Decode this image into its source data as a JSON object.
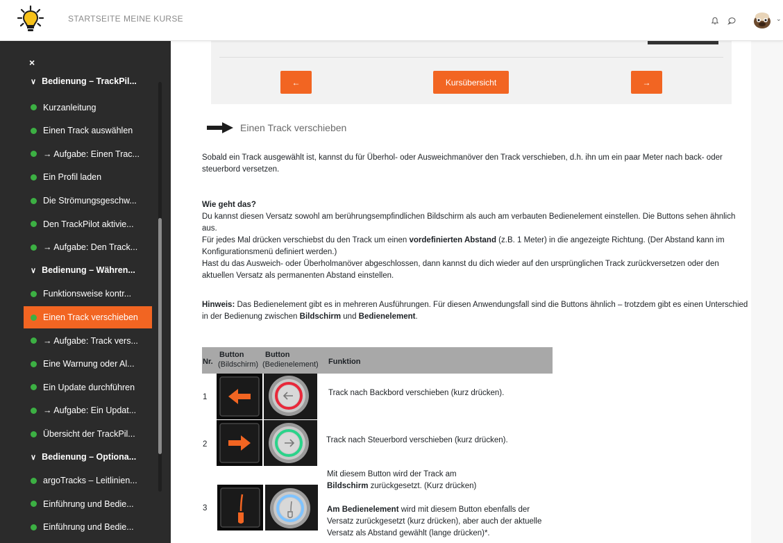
{
  "nav": {
    "links": [
      "STARTSEITE",
      "MEINE KURSE"
    ]
  },
  "sidebar": {
    "close_label": "×",
    "items": [
      {
        "type": "section",
        "label": "Bedienung – TrackPil..."
      },
      {
        "type": "item",
        "label": "Kurzanleitung"
      },
      {
        "type": "item",
        "label": "Einen Track auswählen"
      },
      {
        "type": "item",
        "label": "→ Aufgabe: Einen Trac..."
      },
      {
        "type": "item",
        "label": "Ein Profil laden"
      },
      {
        "type": "item",
        "label": "Die Strömungsgeschw..."
      },
      {
        "type": "item",
        "label": "Den TrackPilot aktivie..."
      },
      {
        "type": "item",
        "label": "→ Aufgabe: Den Track..."
      },
      {
        "type": "section",
        "label": "Bedienung – Währen..."
      },
      {
        "type": "item",
        "label": "Funktionsweise kontr..."
      },
      {
        "type": "item",
        "label": "Einen Track verschieben",
        "active": true
      },
      {
        "type": "item",
        "label": "→ Aufgabe: Track vers..."
      },
      {
        "type": "item",
        "label": "Eine Warnung oder Al..."
      },
      {
        "type": "item",
        "label": "Ein Update durchführen"
      },
      {
        "type": "item",
        "label": "→ Aufgabe: Ein Updat..."
      },
      {
        "type": "item",
        "label": "Übersicht der TrackPil..."
      },
      {
        "type": "section",
        "label": "Bedienung – Optiona..."
      },
      {
        "type": "item",
        "label": "argoTracks – Leitlinien..."
      },
      {
        "type": "item",
        "label": "Einführung und Bedie..."
      },
      {
        "type": "item",
        "label": "Einführung und Bedie..."
      }
    ]
  },
  "navbox": {
    "prev_label": "←",
    "overview_label": "Kursübersicht",
    "next_label": "→"
  },
  "content": {
    "heading": "Einen Track verschieben",
    "intro": "Sobald ein Track ausgewählt ist, kannst du für Überhol- oder Ausweichmanöver den Track verschieben, d.h. ihn um ein paar Meter nach back- oder steuerbord versetzen.",
    "how_title": "Wie geht das?",
    "how_p1": "Du kannst diesen Versatz sowohl am berührungsempfindlichen Bildschirm als auch am verbauten Bedienelement einstellen.  Die Buttons sehen ähnlich aus.",
    "how_p2_a": "Für jedes Mal drücken verschiebst du den Track um einen ",
    "how_p2_bold": "vordefinierten Abstand",
    "how_p2_b": " (z.B. 1 Meter) in die angezeigte Richtung. (Der Abstand kann im Konfigurationsmenü definiert werden.)",
    "how_p3": "Hast du das Ausweich- oder Überholmanöver abgeschlossen, dann kannst du dich wieder auf den ursprünglichen Track zurückversetzen oder den aktuellen Versatz als permanenten Abstand einstellen.",
    "hint_bold": "Hinweis:",
    "hint_a": " Das Bedienelement gibt es in mehreren Ausführungen. Für diesen Anwendungsfall sind die Buttons ähnlich – trotzdem gibt es einen Unterschied in der Bedienung zwischen ",
    "hint_bold2": "Bildschirm",
    "hint_b": " und ",
    "hint_bold3": "Bedienelement",
    "hint_c": "."
  },
  "table": {
    "col_nr": "Nr.",
    "col_btn": "Button",
    "col_btn_sub1": "(Bildschirm)",
    "col_btn_sub2": "(Bedienelement)",
    "col_func": "Funktion",
    "rows": [
      {
        "nr": "1",
        "text": "Track nach Backbord verschieben (kurz drücken)."
      },
      {
        "nr": "2",
        "text": "Track nach Steuerbord verschieben (kurz drücken)."
      },
      {
        "nr": "3",
        "text_a": "Mit diesem Button wird der Track am",
        "text_b_bold": "Bildschirm",
        "text_b": " zurückgesetzt. (Kurz drücken)",
        "text_c_bold": "Am Bedienelement",
        "text_c": " wird mit diesem Button ebenfalls der",
        "text_d": "Versatz zurückgesetzt (kurz drücken), aber auch der aktuelle",
        "text_e": "Versatz als Abstand gewählt (lange drücken)*."
      }
    ]
  },
  "colors": {
    "accent": "#f26522",
    "dot": "#3cb043",
    "sidebar_bg": "#2b2b2b"
  }
}
